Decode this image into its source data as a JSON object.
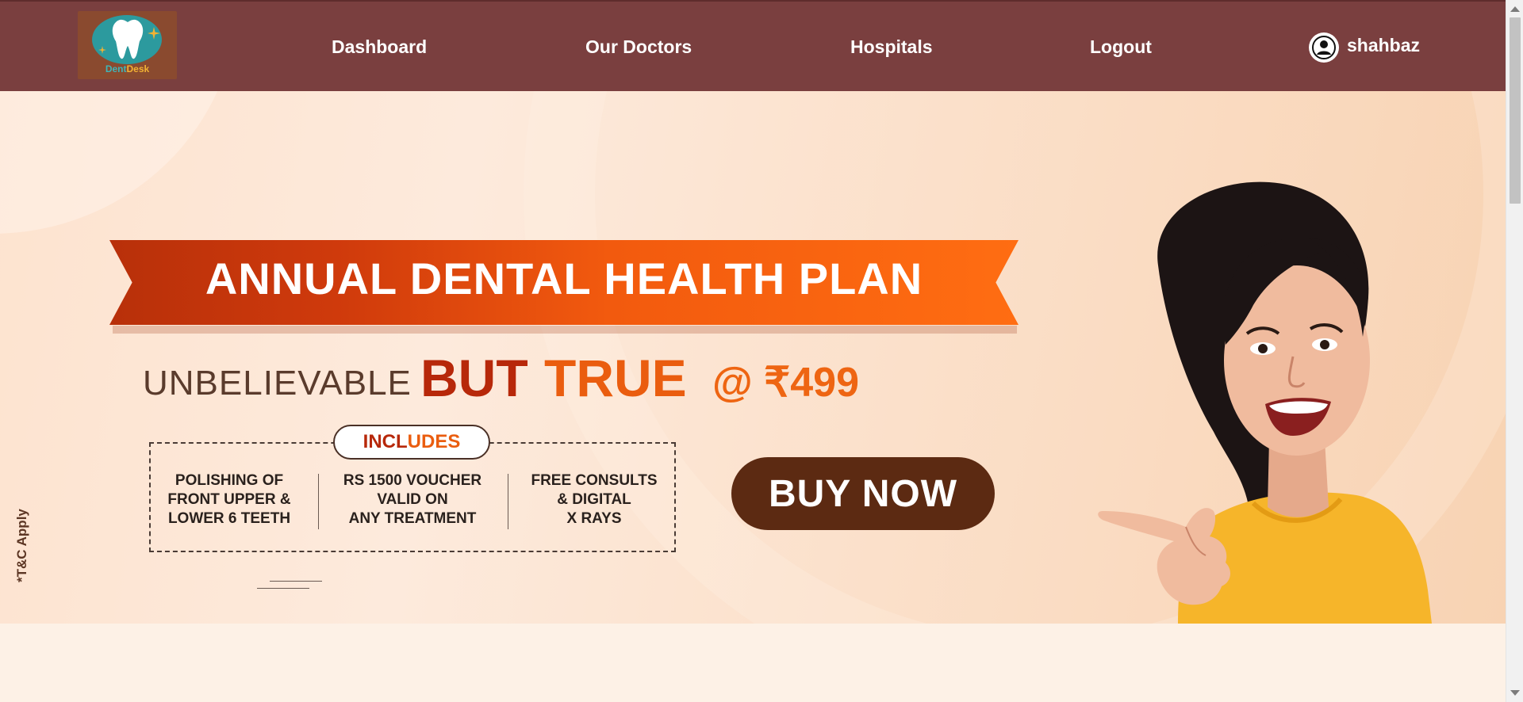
{
  "brand": {
    "logo_word_1": "Dent",
    "logo_word_2": "Desk"
  },
  "nav": {
    "dashboard": "Dashboard",
    "doctors": "Our Doctors",
    "hospitals": "Hospitals",
    "logout": "Logout"
  },
  "user": {
    "name": "shahbaz",
    "icon": "user-circle-icon"
  },
  "banner": {
    "headline": "ANNUAL DENTAL HEALTH PLAN",
    "tag_unbelievable": "UNBELIEVABLE",
    "tag_but": "BUT",
    "tag_true": "TRUE",
    "tag_price": "@ ₹499",
    "includes_a": "INCL",
    "includes_b": "UDES",
    "features": [
      {
        "lines": [
          "POLISHING OF",
          "FRONT UPPER &",
          "LOWER 6 TEETH"
        ]
      },
      {
        "lines": [
          "RS 1500 VOUCHER",
          "VALID ON",
          "ANY TREATMENT"
        ]
      },
      {
        "lines": [
          "FREE CONSULTS",
          "& DIGITAL",
          "X RAYS"
        ]
      }
    ],
    "cta": "BUY NOW",
    "terms": "*T&C Apply"
  },
  "colors": {
    "navbar": "#7a3f3f",
    "cta": "#5c2a12",
    "accent_orange": "#ea5d0f",
    "accent_red": "#b7280a"
  }
}
